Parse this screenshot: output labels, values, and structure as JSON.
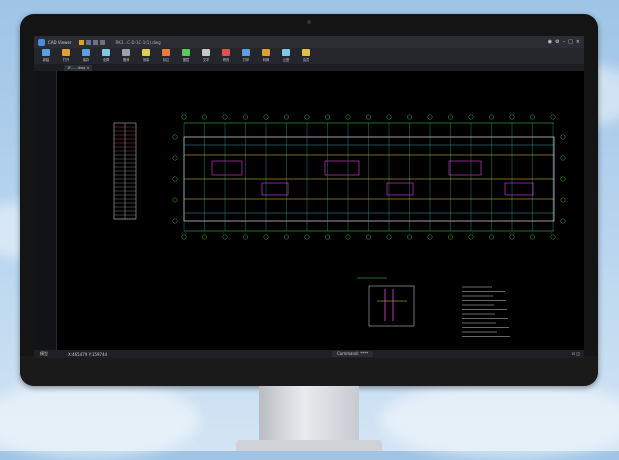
{
  "app": {
    "title": "CAD Viewer",
    "document_title": "RK3...C-D-1C-1(1).dwg"
  },
  "ribbon": [
    {
      "label": "新建",
      "icon": "new-icon",
      "color": "#5aa0e8"
    },
    {
      "label": "打开",
      "icon": "open-icon",
      "color": "#e0a030"
    },
    {
      "label": "保存",
      "icon": "save-icon",
      "color": "#5aa0e8"
    },
    {
      "label": "全屏",
      "icon": "fullscreen-icon",
      "color": "#7ec8e3"
    },
    {
      "label": "撤消",
      "icon": "undo-icon",
      "color": "#9aa3ad"
    },
    {
      "label": "测量",
      "icon": "measure-icon",
      "color": "#e0d050"
    },
    {
      "label": "标注",
      "icon": "dimension-icon",
      "color": "#f07a3a"
    },
    {
      "label": "图层",
      "icon": "layer-icon",
      "color": "#5ac85a"
    },
    {
      "label": "文字",
      "icon": "text-icon",
      "color": "#c8c8c8"
    },
    {
      "label": "修改",
      "icon": "modify-icon",
      "color": "#e05050"
    },
    {
      "label": "打印",
      "icon": "print-icon",
      "color": "#5aa0e8"
    },
    {
      "label": "转换",
      "icon": "convert-icon",
      "color": "#e0a030"
    },
    {
      "label": "云盘",
      "icon": "cloud-icon",
      "color": "#7ec8e3"
    },
    {
      "label": "会员",
      "icon": "vip-icon",
      "color": "#e0c040"
    }
  ],
  "tab": {
    "label": "1F-... .dwg ×"
  },
  "status": {
    "layout_tab": "模型",
    "coords": "X:465479   Y:159744",
    "command": "Command: ****",
    "right": "⊡ ◫"
  }
}
